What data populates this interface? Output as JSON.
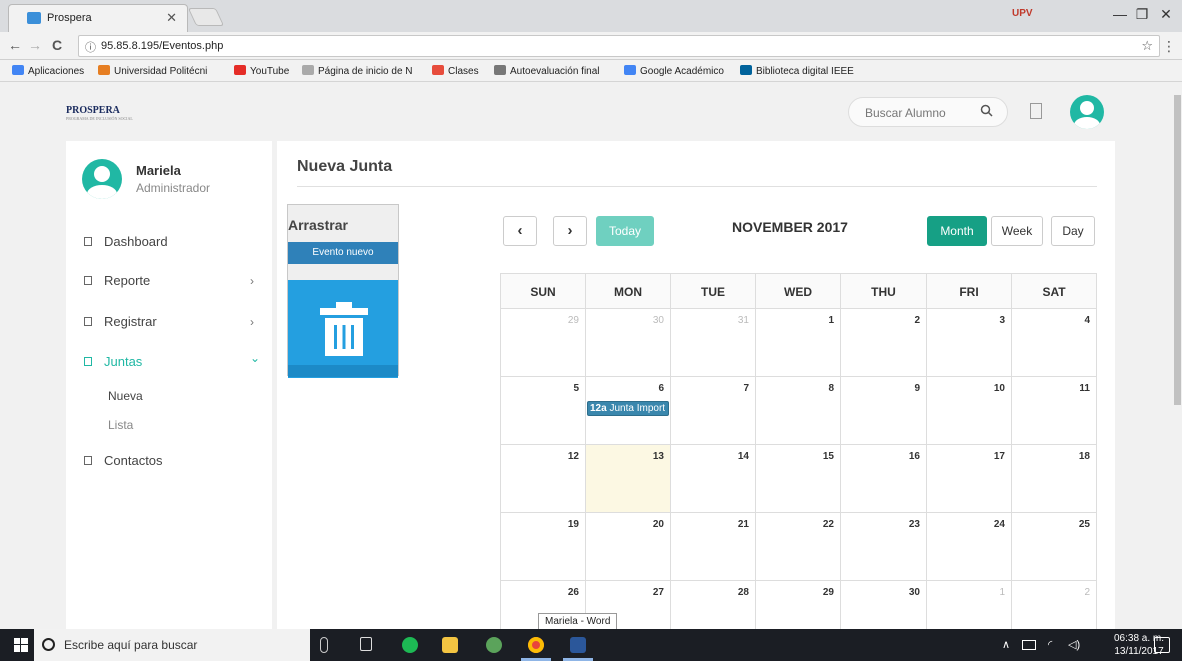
{
  "browser": {
    "tab_title": "Prospera",
    "tab_close": "✕",
    "profile_badge": "UPV",
    "window_controls": {
      "minimize": "—",
      "restore": "❐",
      "close": "✕"
    },
    "nav": {
      "back": "←",
      "forward": "→",
      "reload": "C"
    },
    "url": "95.85.8.195/Eventos.php",
    "star": "☆",
    "menu": "⋮",
    "bookmarks": [
      {
        "label": "Aplicaciones",
        "color": "#4285f4"
      },
      {
        "label": "Universidad Politécni",
        "color": "#e67e22"
      },
      {
        "label": "YouTube",
        "color": "#e52d27"
      },
      {
        "label": "Página de inicio de N",
        "color": "#888888"
      },
      {
        "label": "Clases",
        "color": "#e74c3c"
      },
      {
        "label": "Autoevaluación final",
        "color": "#666666"
      },
      {
        "label": "Google Académico",
        "color": "#4285f4"
      },
      {
        "label": "Biblioteca digital IEEE",
        "color": "#00629b"
      }
    ]
  },
  "header": {
    "logo": "PROSPERA",
    "logo_sub": "PROGRAMA DE INCLUSIÓN SOCIAL",
    "search_placeholder": "Buscar Alumno",
    "search_icon": "search-icon"
  },
  "sidebar": {
    "user_name": "Mariela",
    "user_role": "Administrador",
    "items": [
      {
        "label": "Dashboard",
        "chevron": ""
      },
      {
        "label": "Reporte",
        "chevron": "›"
      },
      {
        "label": "Registrar",
        "chevron": "›"
      },
      {
        "label": "Juntas",
        "chevron": "⌄"
      },
      {
        "label": "Contactos",
        "chevron": ""
      }
    ],
    "subitems": [
      "Nueva",
      "Lista"
    ]
  },
  "main": {
    "title": "Nueva Junta",
    "drag_title": "Arrastrar",
    "drag_event": "Evento nuevo",
    "calendar": {
      "prev": "‹",
      "next": "›",
      "today": "Today",
      "title": "NOVEMBER 2017",
      "views": [
        "Month",
        "Week",
        "Day"
      ],
      "active_view": "Month",
      "day_headers": [
        "SUN",
        "MON",
        "TUE",
        "WED",
        "THU",
        "FRI",
        "SAT"
      ],
      "weeks": [
        [
          "29",
          "30",
          "31",
          "1",
          "2",
          "3",
          "4"
        ],
        [
          "5",
          "6",
          "7",
          "8",
          "9",
          "10",
          "11"
        ],
        [
          "12",
          "13",
          "14",
          "15",
          "16",
          "17",
          "18"
        ],
        [
          "19",
          "20",
          "21",
          "22",
          "23",
          "24",
          "25"
        ],
        [
          "26",
          "27",
          "28",
          "29",
          "30",
          "1",
          "2"
        ]
      ],
      "today_date": "13",
      "event_time": "12a",
      "event_title": "Junta Import"
    }
  },
  "tooltip": "Mariela - Word",
  "taskbar": {
    "search_placeholder": "Escribe aquí para buscar",
    "time": "06:38 a. m.",
    "date": "13/11/2017"
  }
}
